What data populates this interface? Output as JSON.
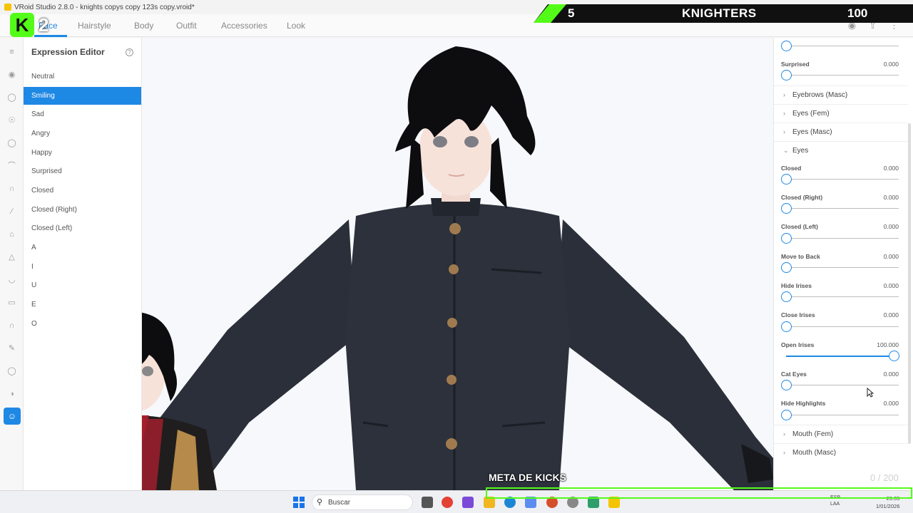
{
  "window": {
    "title": "VRoid Studio 2.8.0 - knights copys copy 123s copy.vroid*"
  },
  "nav": {
    "tabs": [
      "Face",
      "Hairstyle",
      "Body",
      "Outfit",
      "Accessories",
      "Look"
    ],
    "active_tab": "Face"
  },
  "overlay": {
    "kick_badge_number": "2",
    "score_left": "5",
    "score_title": "KNIGHTERS",
    "score_right": "100",
    "meta_label": "META DE KICKS",
    "meta_count": "0  / 200"
  },
  "expression_editor": {
    "title": "Expression Editor",
    "items": [
      "Neutral",
      "Smiling",
      "Sad",
      "Angry",
      "Happy",
      "Surprised",
      "Closed",
      "Closed (Right)",
      "Closed (Left)",
      "A",
      "I",
      "U",
      "E",
      "O"
    ],
    "selected": "Smiling"
  },
  "right_panel": {
    "top_slider": {
      "value": "0.000",
      "fraction": 0
    },
    "surprised": {
      "label": "Surprised",
      "value": "0.000",
      "fraction": 0
    },
    "groups_collapsed": [
      "Eyebrows (Masc)",
      "Eyes (Fem)",
      "Eyes (Masc)"
    ],
    "expanded_group": "Eyes",
    "eye_sliders": [
      {
        "label": "Closed",
        "value": "0.000",
        "fraction": 0
      },
      {
        "label": "Closed (Right)",
        "value": "0.000",
        "fraction": 0
      },
      {
        "label": "Closed (Left)",
        "value": "0.000",
        "fraction": 0
      },
      {
        "label": "Move to Back",
        "value": "0.000",
        "fraction": 0
      },
      {
        "label": "Hide Irises",
        "value": "0.000",
        "fraction": 0
      },
      {
        "label": "Close Irises",
        "value": "0.000",
        "fraction": 0
      },
      {
        "label": "Open Irises",
        "value": "100.000",
        "fraction": 1
      },
      {
        "label": "Cat Eyes",
        "value": "0.000",
        "fraction": 0
      },
      {
        "label": "Hide Highlights",
        "value": "0.000",
        "fraction": 0
      }
    ],
    "groups_after": [
      "Mouth (Fem)",
      "Mouth (Masc)"
    ]
  },
  "taskbar": {
    "search_placeholder": "Buscar",
    "lang_top": "ESP",
    "lang_bottom": "LAA",
    "time": "23:35",
    "date": "1/01/2026"
  },
  "colors": {
    "accent": "#1e88e5",
    "kick_green": "#53fc18",
    "jacket": "#2a2f3a"
  }
}
